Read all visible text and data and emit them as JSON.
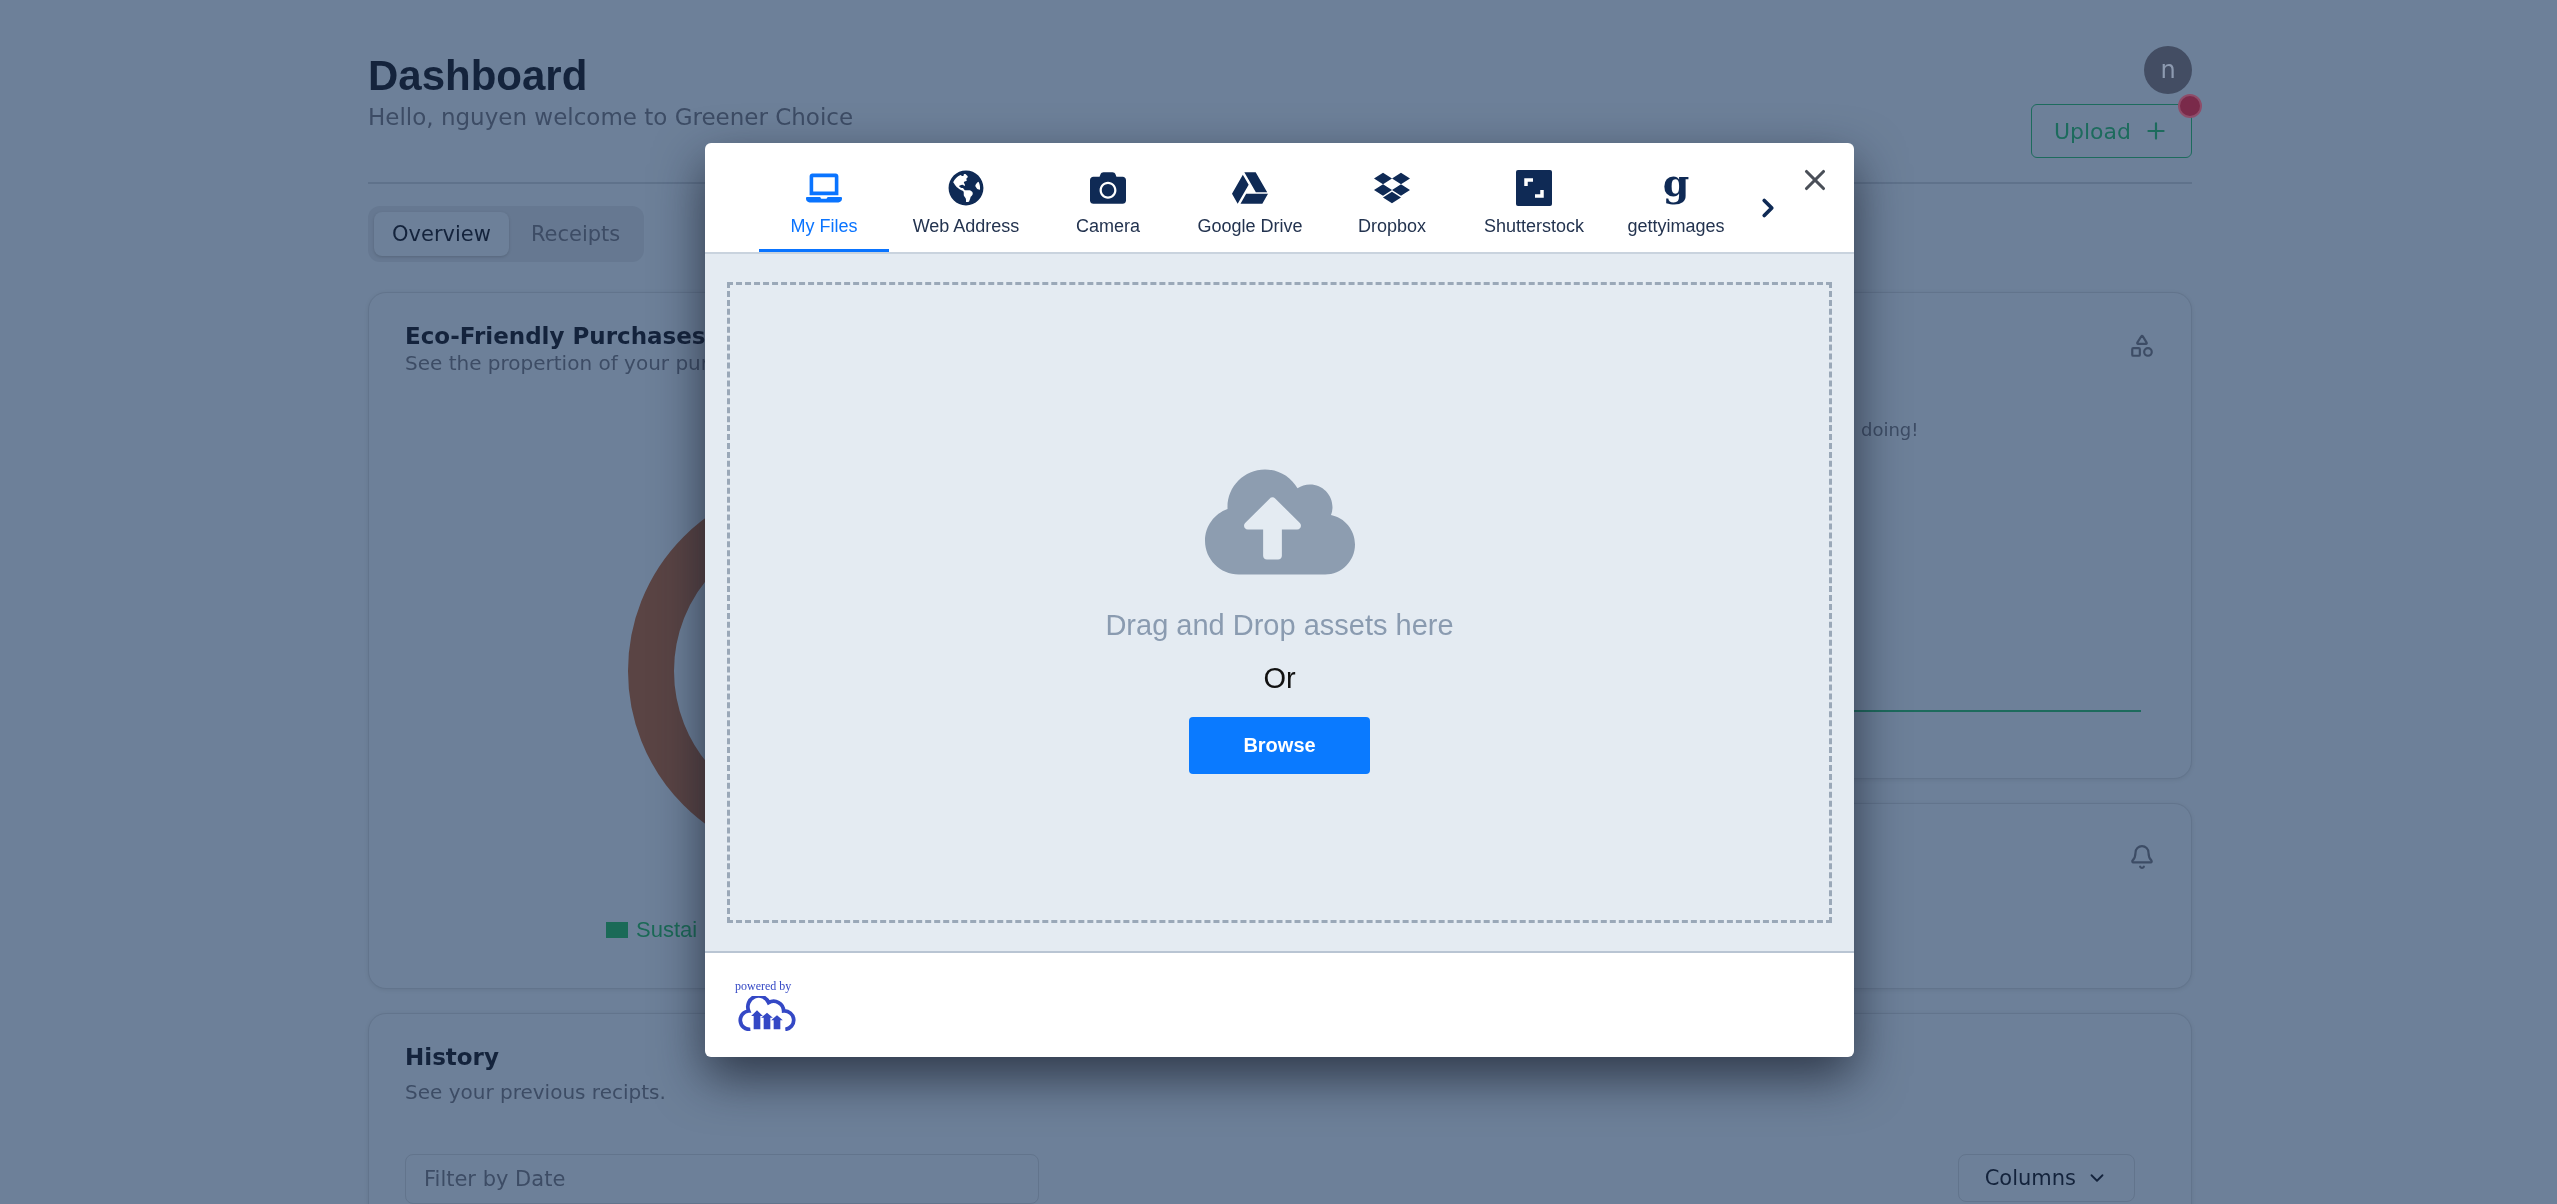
{
  "header": {
    "title": "Dashboard",
    "subtitle": "Hello, nguyen welcome to Greener Choice",
    "avatar": "n",
    "upload_button": "Upload"
  },
  "tabs": [
    {
      "label": "Overview",
      "selected": true
    },
    {
      "label": "Receipts",
      "selected": false
    }
  ],
  "eco_card": {
    "title": "Eco-Friendly Purchases",
    "subtitle": "See the propertion of your pur",
    "legend": [
      {
        "label": "Sustai",
        "color": "#1b6a57"
      }
    ]
  },
  "insight_card": {
    "text": "doing!"
  },
  "history": {
    "title": "History",
    "subtitle": "See your previous recipts.",
    "filter": {
      "placeholder": "Filter by Date"
    },
    "columns_button": "Columns"
  },
  "upload_dialog": {
    "sources": [
      {
        "label": "My Files",
        "kind": "laptop",
        "selected": true
      },
      {
        "label": "Web Address",
        "kind": "globe",
        "selected": false
      },
      {
        "label": "Camera",
        "kind": "camera",
        "selected": false
      },
      {
        "label": "Google Drive",
        "kind": "drive",
        "selected": false
      },
      {
        "label": "Dropbox",
        "kind": "dropbox",
        "selected": false
      },
      {
        "label": "Shutterstock",
        "kind": "shutterstock",
        "selected": false
      },
      {
        "label": "gettyimages",
        "kind": "glyph",
        "glyph": "g",
        "selected": false
      }
    ],
    "drop_text": "Drag and Drop assets here",
    "or_text": "Or",
    "browse_button": "Browse",
    "powered_by": "powered by"
  }
}
